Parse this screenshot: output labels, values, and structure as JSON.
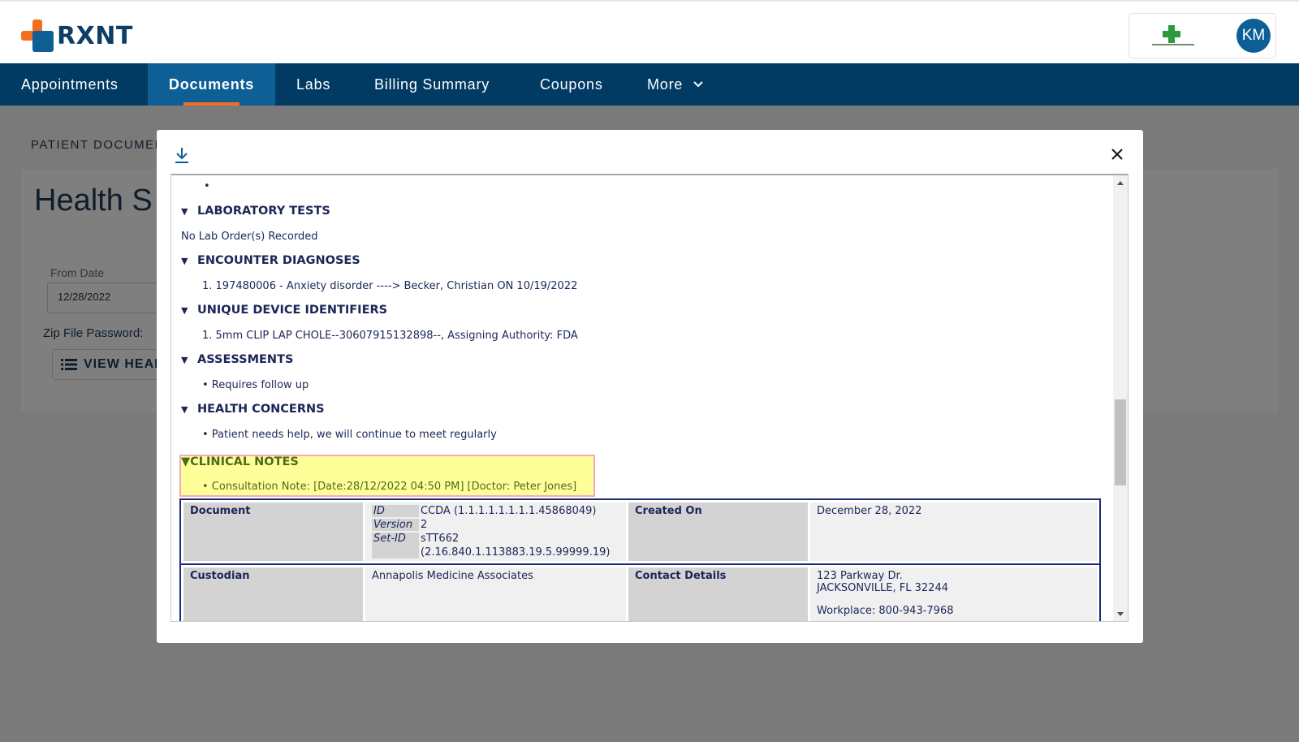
{
  "brand": {
    "name": "RXNT"
  },
  "account": {
    "initials": "KM"
  },
  "nav": {
    "items": [
      "Appointments",
      "Documents",
      "Labs",
      "Billing Summary",
      "Coupons",
      "More"
    ],
    "active": "Documents"
  },
  "background_page": {
    "breadcrumb": "PATIENT DOCUMEN",
    "title": "Health S",
    "from_date_label": "From Date",
    "from_date_value": "12/28/2022",
    "zip_password_label": "Zip File Password:",
    "view_button": "VIEW HEAL"
  },
  "document": {
    "sections": [
      {
        "title": "LABORATORY TESTS",
        "lines": [
          "No Lab Order(s) Recorded"
        ]
      },
      {
        "title": "ENCOUNTER DIAGNOSES",
        "lines": [
          "1. 197480006 - Anxiety disorder ----> Becker, Christian ON 10/19/2022"
        ]
      },
      {
        "title": "UNIQUE DEVICE IDENTIFIERS",
        "lines": [
          "1. 5mm CLIP LAP CHOLE--30607915132898--, Assigning Authority: FDA"
        ]
      },
      {
        "title": "ASSESSMENTS",
        "lines": [
          "• Requires follow up"
        ]
      },
      {
        "title": "HEALTH CONCERNS",
        "lines": [
          "• Patient needs help, we will continue to meet regularly"
        ]
      },
      {
        "title": "CLINICAL NOTES",
        "lines": [
          "• Consultation Note: [Date:28/12/2022 04:50 PM] [Doctor: Peter Jones]"
        ]
      }
    ],
    "top_bullet": "•",
    "meta": {
      "document_label": "Document",
      "id_label": "ID",
      "id_value": "CCDA (1.1.1.1.1.1.1.1.45868049)",
      "version_label": "Version",
      "version_value": "2",
      "setid_label": "Set-ID",
      "setid_value": "sTT662",
      "setid_value2": "(2.16.840.1.113883.19.5.99999.19)",
      "created_on_label": "Created On",
      "created_on_value": "December 28, 2022",
      "custodian_label": "Custodian",
      "custodian_value": "Annapolis Medicine Associates",
      "contact_label": "Contact Details",
      "contact_line1": "123 Parkway Dr.",
      "contact_line2": "JACKSONVILLE, FL 32244",
      "contact_line3": "Workplace: 800-943-7968"
    }
  },
  "colors": {
    "nav_bg": "#013a63",
    "nav_active_bg": "#0e5f96",
    "nav_active_underline": "#f26f21",
    "highlight_bg": "#ffff99",
    "highlight_border": "#f4a9b8",
    "doc_text": "#1b2657"
  },
  "icons": {
    "download": "download-icon",
    "close": "close-icon",
    "more_chevron": "chevron-down-icon",
    "list": "list-icon",
    "section_toggle": "triangle-down-icon"
  }
}
